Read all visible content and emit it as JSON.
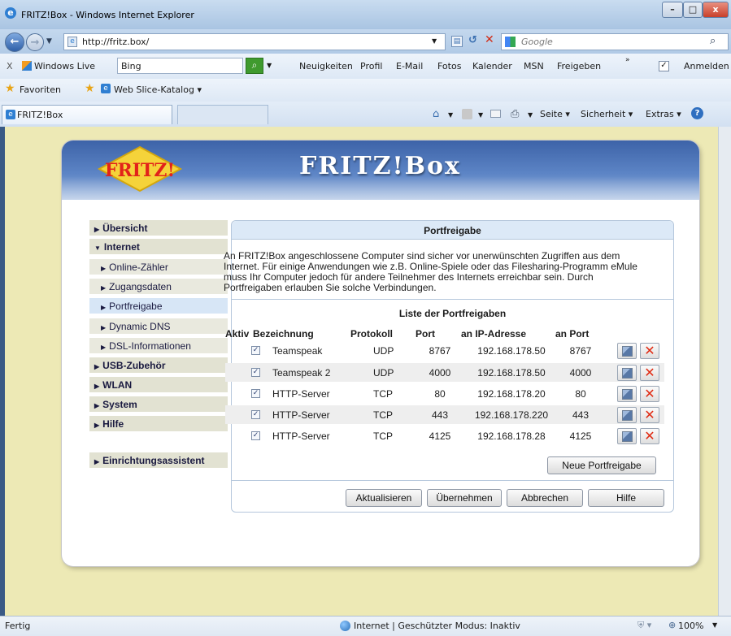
{
  "window": {
    "title": "FRITZ!Box - Windows Internet Explorer"
  },
  "address_bar": {
    "url": "http://fritz.box/",
    "search_placeholder": "Google"
  },
  "live_toolbar": {
    "close": "X",
    "windows_live": "Windows Live",
    "search_value": "Bing",
    "links": [
      "Neuigkeiten",
      "Profil",
      "E-Mail",
      "Fotos",
      "Kalender",
      "MSN",
      "Freigeben"
    ],
    "more": "»",
    "signin": "Anmelden"
  },
  "favorites_bar": {
    "favorites": "Favoriten",
    "web_slice": "Web Slice-Katalog ▾"
  },
  "tab": {
    "label": "FRITZ!Box"
  },
  "command_bar": {
    "page": "Seite",
    "security": "Sicherheit",
    "extras": "Extras"
  },
  "fritz": {
    "logo_text": "FRITZ!",
    "header_title": "FRITZ!Box"
  },
  "nav": [
    {
      "label": "Übersicht",
      "level": "top"
    },
    {
      "label": "Internet",
      "level": "top",
      "expanded": true
    },
    {
      "label": "Online-Zähler",
      "level": "sub"
    },
    {
      "label": "Zugangsdaten",
      "level": "sub"
    },
    {
      "label": "Portfreigabe",
      "level": "sub",
      "selected": true
    },
    {
      "label": "Dynamic DNS",
      "level": "sub"
    },
    {
      "label": "DSL-Informationen",
      "level": "sub"
    },
    {
      "label": "USB-Zubehör",
      "level": "top"
    },
    {
      "label": "WLAN",
      "level": "top"
    },
    {
      "label": "System",
      "level": "top"
    },
    {
      "label": "Hilfe",
      "level": "top"
    },
    {
      "label": "Einrichtungsassistent",
      "level": "top"
    }
  ],
  "portfreigabe": {
    "title": "Portfreigabe",
    "intro_lines": [
      "An FRITZ!Box angeschlossene Computer sind sicher vor unerwünschten Zugriffen aus dem",
      "Internet. Für einige Anwendungen wie z.B. Online-Spiele oder das Filesharing-Programm eMule",
      "muss Ihr Computer jedoch für andere Teilnehmer des Internets erreichbar sein. Durch",
      "Portfreigaben erlauben Sie solche Verbindungen."
    ],
    "list_title": "Liste der Portfreigaben",
    "columns": [
      "Aktiv",
      "Bezeichnung",
      "Protokoll",
      "Port",
      "an IP-Adresse",
      "an Port"
    ],
    "rows": [
      {
        "active": true,
        "name": "Teamspeak",
        "protocol": "UDP",
        "port": "8767",
        "ip": "192.168.178.50",
        "to_port": "8767"
      },
      {
        "active": true,
        "name": "Teamspeak 2",
        "protocol": "UDP",
        "port": "4000",
        "ip": "192.168.178.50",
        "to_port": "4000"
      },
      {
        "active": true,
        "name": "HTTP-Server",
        "protocol": "TCP",
        "port": "80",
        "ip": "192.168.178.20",
        "to_port": "80"
      },
      {
        "active": true,
        "name": "HTTP-Server",
        "protocol": "TCP",
        "port": "443",
        "ip": "192.168.178.220",
        "to_port": "443"
      },
      {
        "active": true,
        "name": "HTTP-Server",
        "protocol": "TCP",
        "port": "4125",
        "ip": "192.168.178.28",
        "to_port": "4125"
      }
    ],
    "new_button": "Neue Portfreigabe",
    "buttons": {
      "refresh": "Aktualisieren",
      "apply": "Übernehmen",
      "cancel": "Abbrechen",
      "help": "Hilfe"
    }
  },
  "status_bar": {
    "left": "Fertig",
    "zone": "Internet | Geschützter Modus: Inaktiv",
    "zoom": "100%"
  },
  "colors": {
    "accent_blue": "#3d63a8",
    "page_background": "#ede9b5",
    "delete_red": "#e02a12"
  }
}
